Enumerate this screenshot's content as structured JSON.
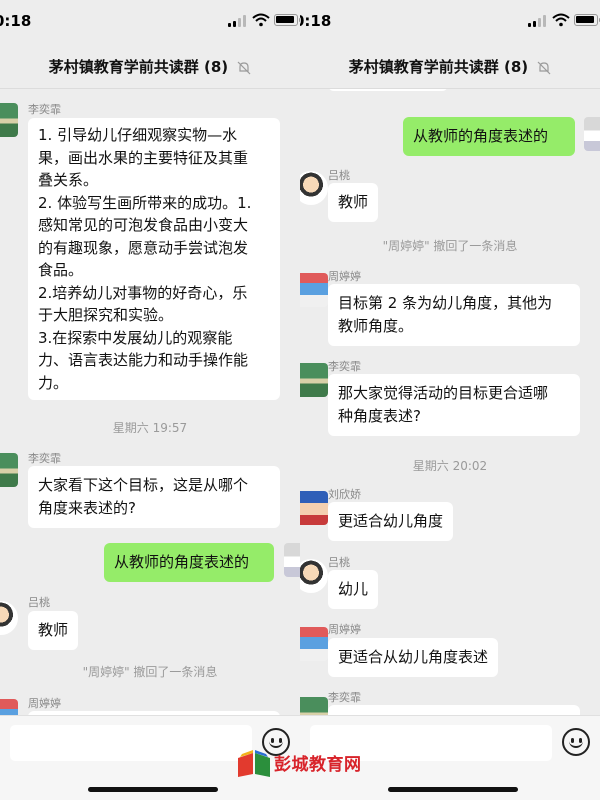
{
  "status_bar": {
    "time": "0:18"
  },
  "chat": {
    "title": "茅村镇教育学前共读群 (8)"
  },
  "left_pane": {
    "messages": [
      {
        "sender": "李奕霏",
        "text_lines": [
          "1. 引导幼儿仔细观察实物—水",
          "果，画出水果的主要特征及其重",
          "叠关系。",
          "2. 体验写生画所带来的成功。1.",
          "感知常见的可泡发食品由小变大",
          "的有趣现象，愿意动手尝试泡发",
          "食品。",
          "2.培养幼儿对事物的好奇心，乐",
          "于大胆探究和实验。",
          "3.在探索中发展幼儿的观察能",
          "力、语言表达能力和动手操作能",
          "力。"
        ]
      },
      {
        "system": "星期六 19:57"
      },
      {
        "sender": "李奕霏",
        "text_lines": [
          "大家看下这个目标，这是从哪个",
          "角度来表述的?"
        ]
      },
      {
        "outgoing_text": "从教师的角度表述的"
      },
      {
        "sender": "吕桃",
        "text": "教师"
      },
      {
        "system": "\"周婷婷\" 撤回了一条消息"
      },
      {
        "sender": "周婷婷"
      }
    ]
  },
  "right_pane": {
    "messages": [
      {
        "outgoing_text": "从教师的角度表述的"
      },
      {
        "sender": "吕桃",
        "text": "教师"
      },
      {
        "system": "\"周婷婷\" 撤回了一条消息"
      },
      {
        "sender": "周婷婷",
        "text_lines": [
          " 目标第 2 条为幼儿角度，其他为",
          "教师角度。"
        ]
      },
      {
        "sender": "李奕霏",
        "text_lines": [
          "那大家觉得活动的目标更合适哪",
          "种角度表述?"
        ]
      },
      {
        "system": "星期六 20:02"
      },
      {
        "sender": "刘欣娇",
        "text": "更适合幼儿角度"
      },
      {
        "sender": "吕桃",
        "text": "幼儿"
      },
      {
        "sender": "周婷婷",
        "text": "更适合从幼儿角度表述"
      },
      {
        "sender": "李奕霏"
      }
    ]
  },
  "watermark": {
    "text": "彭城教育网"
  },
  "icons": [
    "signal-icon",
    "wifi-icon",
    "battery-icon",
    "mute-bell-icon",
    "emoji-icon",
    "avatar"
  ],
  "colors": {
    "outgoing_bubble": "#95ec69",
    "background": "#ededed",
    "incoming_bubble": "#ffffff",
    "watermark": "#d8232a"
  }
}
